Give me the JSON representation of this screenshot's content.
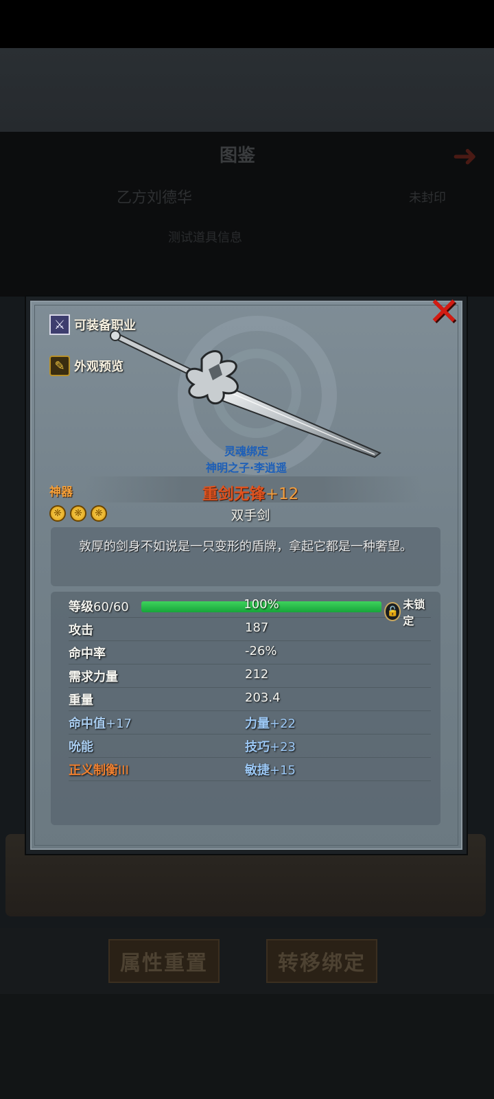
{
  "background": {
    "title": "图鉴",
    "faint_left": "乙方刘德华",
    "faint_right": "未封印",
    "faint_mid": "测试道具信息",
    "buttons": {
      "reset": "属性重置",
      "transfer": "转移绑定"
    }
  },
  "dialog": {
    "side_links": {
      "class": "可装备职业",
      "appearance": "外观预览"
    },
    "icons": {
      "class": "crossed-swords-icon",
      "appearance": "paint-brush-icon",
      "close": "close-icon",
      "lock": "padlock-icon",
      "star": "snowflake-star-icon"
    },
    "soul_bind": "灵魂绑定",
    "owner": "神明之子·李逍遥",
    "grade": "神器",
    "stars": 3,
    "item_name": "重剑无锋",
    "item_plus": "+12",
    "item_type": "双手剑",
    "description": "敦厚的剑身不如说是一只变形的盾牌，拿起它都是一种奢望。",
    "level": {
      "label": "等级",
      "value": "60/60",
      "progress": 1.0,
      "progress_text": "100%",
      "lock_text": "未锁定"
    },
    "stats": [
      {
        "k": "攻击",
        "v": "187"
      },
      {
        "k": "命中率",
        "v": "-26%"
      },
      {
        "k": "需求力量",
        "v": "212"
      },
      {
        "k": "重量",
        "v": "203.4"
      }
    ],
    "bonus": [
      {
        "k": "命中值",
        "kp": "+17",
        "v": "力量",
        "vp": "+22"
      },
      {
        "k": "吮能",
        "kp": "",
        "v": "技巧",
        "vp": "+23"
      },
      {
        "k": "正义制衡",
        "kp": "III",
        "v": "敏捷",
        "vp": "+15"
      }
    ]
  },
  "colors": {
    "accent_name": "#e0531f",
    "grade": "#f5a03a",
    "progress": "#17a53a",
    "close": "#d21b12"
  }
}
